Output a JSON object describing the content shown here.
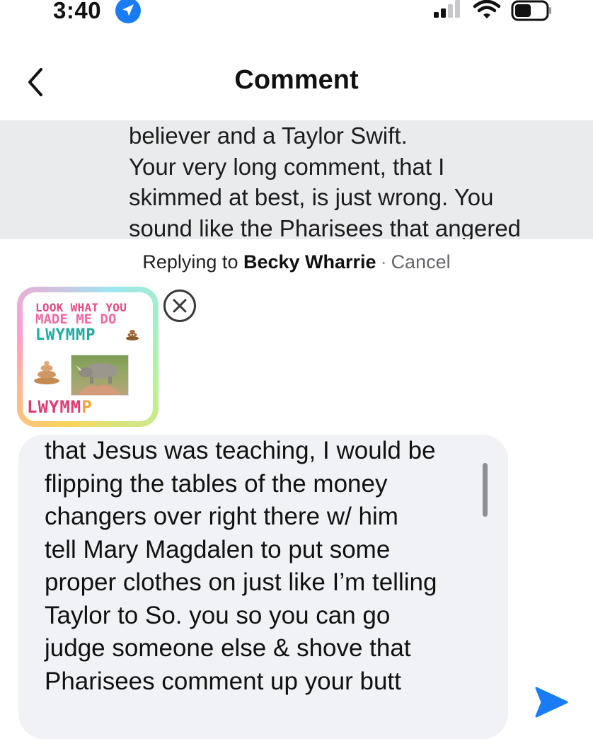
{
  "status_bar": {
    "time": "3:40"
  },
  "nav": {
    "title": "Comment"
  },
  "quoted_comment": {
    "lines": [
      "believer and a Taylor Swift.",
      "Your very long comment, that I",
      "skimmed at best, is just wrong. You",
      "sound like the Pharisees that angered"
    ]
  },
  "reply_bar": {
    "prefix": "Replying to ",
    "name": "Becky Wharrie",
    "separator": "·",
    "cancel_label": "Cancel"
  },
  "sticker": {
    "line1": "LOOK WHAT YOU",
    "line2": "MADE ME DO",
    "line3": "LWYMMP",
    "line4_main": "LWYMM",
    "line4_end": "P"
  },
  "composer": {
    "lines": [
      "that Jesus was teaching, I would be",
      "flipping the tables of the money",
      "changers over right there w/  him",
      "tell Mary Magdalen to put some",
      "proper clothes on just like I’m telling",
      "Taylor to So.  you so you can go",
      "judge someone else & shove that",
      "Pharisees comment up your butt"
    ]
  },
  "icons": {
    "back": "chevron-left-icon",
    "location": "location-arrow-icon",
    "signal": "cellular-signal-icon",
    "wifi": "wifi-icon",
    "battery": "battery-icon",
    "remove": "close-circle-icon",
    "send": "send-icon"
  },
  "colors": {
    "accent": "#1a7cf5",
    "quoted_bg": "#eaebed",
    "composer_bg": "#f0f2f5",
    "muted_text": "#65676b"
  }
}
